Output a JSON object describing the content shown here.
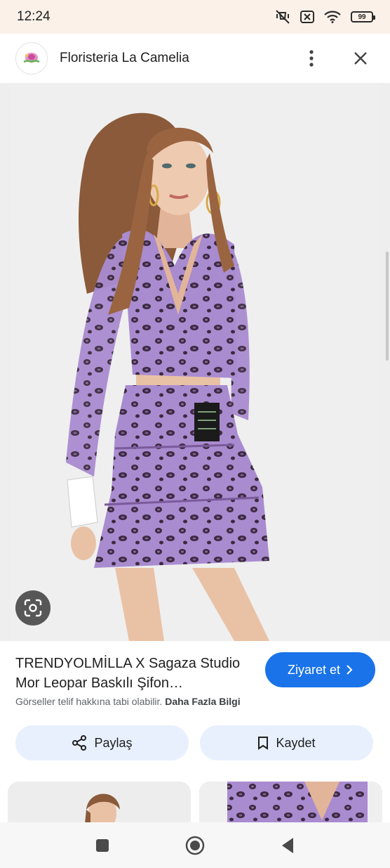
{
  "status_bar": {
    "time": "12:24",
    "battery": "99",
    "icons": [
      "mute-vibrate-icon",
      "sim-off-icon",
      "wifi-icon",
      "battery-icon"
    ]
  },
  "header": {
    "site_name": "Floristeria La Camelia",
    "logo_icon": "flower-logo-icon",
    "menu_icon": "more-vert-icon",
    "close_icon": "close-icon"
  },
  "image": {
    "lens_icon": "lens-icon",
    "photo_colors": {
      "background": "#eeeeee",
      "outfit": "#a98bd0",
      "spots": "#3b2a3e"
    }
  },
  "result": {
    "title": "TRENDYOLMİLLA X Sagaza Studio Mor Leopar Baskılı Şifon…",
    "visit_label": "Ziyaret et",
    "copyright_text": "Görseller telif hakkına tabi olabilir.",
    "more_info_label": "Daha Fazla Bilgi",
    "share_label": "Paylaş",
    "save_label": "Kaydet"
  },
  "colors": {
    "accent": "#1a73e8",
    "pill_bg": "#e8f0fe",
    "status_bg": "#fbf1e9"
  },
  "nav": {
    "icons": [
      "recents-square-icon",
      "home-circle-icon",
      "back-triangle-icon"
    ]
  }
}
